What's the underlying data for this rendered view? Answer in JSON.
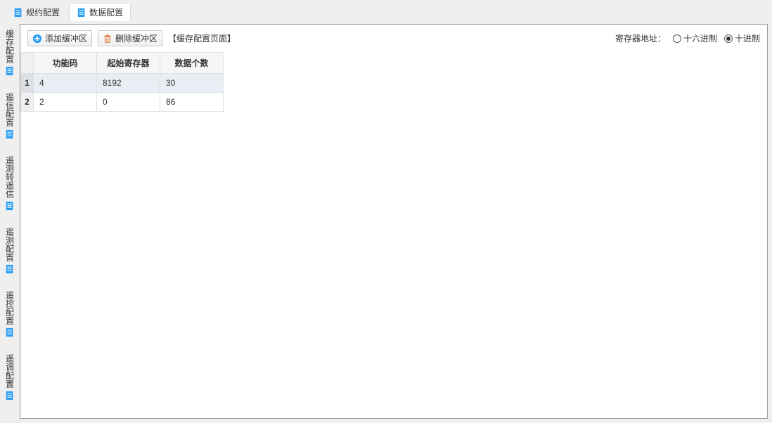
{
  "topTabs": [
    {
      "label": "规约配置",
      "active": false
    },
    {
      "label": "数据配置",
      "active": true
    }
  ],
  "sideTabs": [
    {
      "label": "缓存配置"
    },
    {
      "label": "遥信配置"
    },
    {
      "label": "遥测转遥信"
    },
    {
      "label": "遥测配置"
    },
    {
      "label": "遥控配置"
    },
    {
      "label": "遥调配置"
    }
  ],
  "toolbar": {
    "add_label": "添加缓冲区",
    "delete_label": "删除缓冲区",
    "page_label": "【缓存配置页面】",
    "reg_addr_label": "寄存器地址：",
    "radio_hex": "十六进制",
    "radio_dec": "十进制",
    "radio_selected": "dec"
  },
  "table": {
    "headers": [
      "功能码",
      "起始寄存器",
      "数据个数"
    ],
    "rows": [
      {
        "n": "1",
        "fn": "4",
        "start": "8192",
        "count": "30",
        "selected": true
      },
      {
        "n": "2",
        "fn": "2",
        "start": "0",
        "count": "86",
        "selected": false
      }
    ]
  }
}
